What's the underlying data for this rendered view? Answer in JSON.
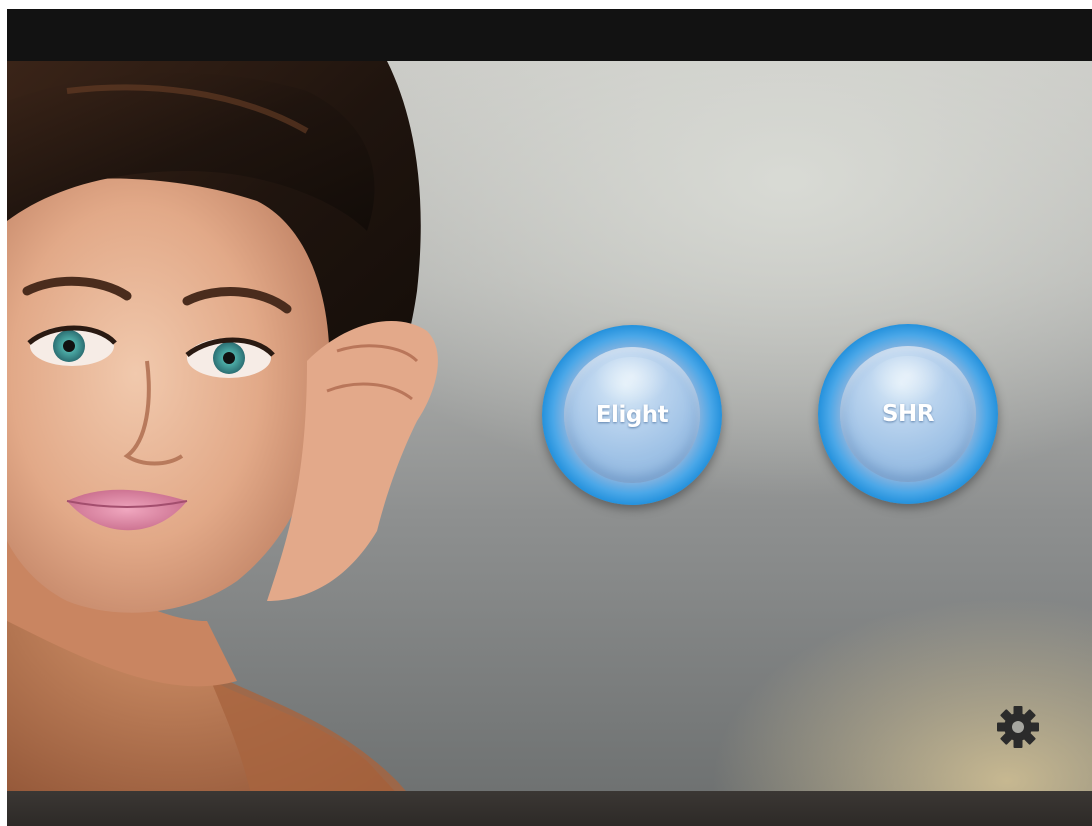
{
  "buttons": {
    "elight_label": "Elight",
    "shr_label": "SHR"
  },
  "icons": {
    "settings": "gear-icon"
  },
  "colors": {
    "button_ring": "#1e8edb",
    "button_face": "#9fc2e6",
    "top_bar": "#121212",
    "bottom_bar": "#2d2a27"
  }
}
